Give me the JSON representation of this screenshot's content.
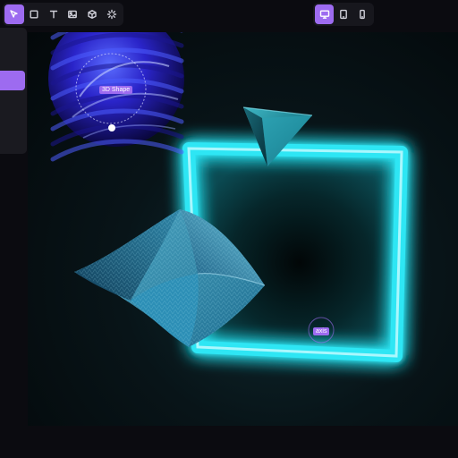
{
  "toolbar": {
    "tools": [
      {
        "name": "select-tool",
        "icon": "cursor-icon",
        "active": true
      },
      {
        "name": "rectangle-tool",
        "icon": "square-icon",
        "active": false
      },
      {
        "name": "text-tool",
        "icon": "text-icon",
        "active": false
      },
      {
        "name": "image-tool",
        "icon": "image-icon",
        "active": false
      },
      {
        "name": "3d-tool",
        "icon": "cube-icon",
        "active": false
      },
      {
        "name": "effects-tool",
        "icon": "sparkle-icon",
        "active": false
      }
    ],
    "devices": [
      {
        "name": "desktop-view",
        "icon": "monitor-icon",
        "active": true
      },
      {
        "name": "tablet-view",
        "icon": "tablet-icon",
        "active": false
      },
      {
        "name": "mobile-view",
        "icon": "phone-icon",
        "active": false
      }
    ]
  },
  "canvas": {
    "shape_label": "3D Shape",
    "axis_label": "axis"
  },
  "colors": {
    "accent": "#9d6bf0",
    "neon": "#2fe6f4",
    "background": "#0b0b10"
  }
}
